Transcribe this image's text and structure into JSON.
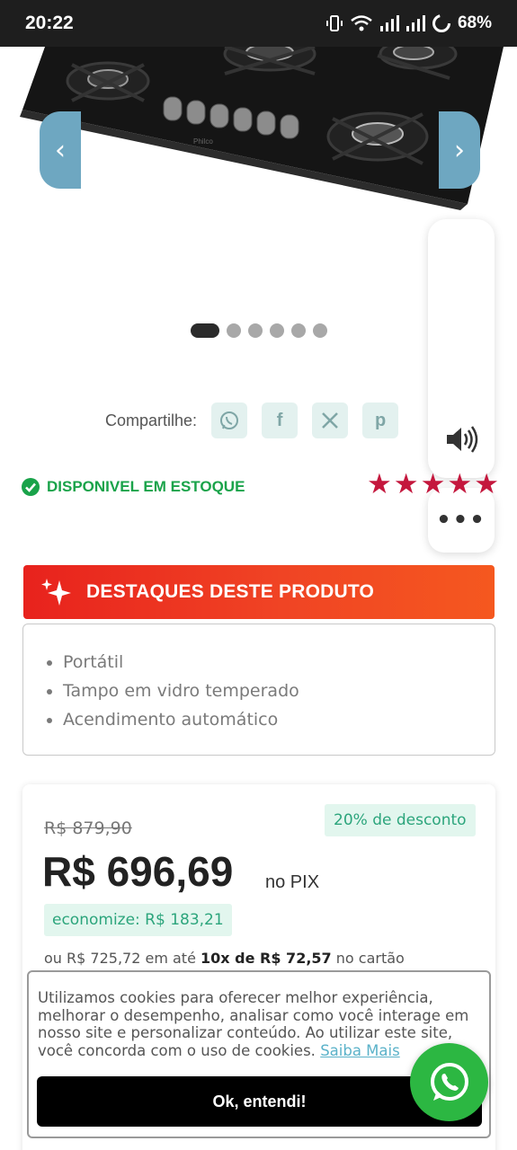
{
  "status_bar": {
    "time": "20:22",
    "battery": "68%",
    "icons": [
      "vibrate-icon",
      "wifi-icon",
      "signal-icon",
      "signal-icon",
      "battery-icon"
    ]
  },
  "carousel": {
    "dot_count": 6,
    "active_index": 0
  },
  "share": {
    "label": "Compartilhe:",
    "networks": [
      {
        "name": "whatsapp",
        "glyph": "✆"
      },
      {
        "name": "facebook",
        "glyph": "f"
      },
      {
        "name": "x",
        "glyph": "𝕏"
      },
      {
        "name": "pinterest",
        "glyph": "p"
      }
    ]
  },
  "stock": {
    "label": "DISPONIVEL EM ESTOQUE",
    "color": "#1aa34a"
  },
  "rating": {
    "stars": 5,
    "color": "#c4173d"
  },
  "highlights": {
    "title": "DESTAQUES DESTE PRODUTO",
    "items": [
      "Portátil",
      "Tampo em vidro temperado",
      "Acendimento automático"
    ]
  },
  "price": {
    "old": "R$ 879,90",
    "discount": "20% de desconto",
    "pix_price": "R$ 696,69",
    "pix_label": "no PIX",
    "savings": "economize: R$ 183,21",
    "installments_prefix": "ou R$ 725,72 em até",
    "installments_bold": "10x de R$ 72,57",
    "installments_suffix": "no cartão"
  },
  "cookie": {
    "text": "Utilizamos cookies para oferecer melhor experiência, melhorar o desempenho, analisar como você interage em nosso site e personalizar conteúdo. Ao utilizar este site, você concorda com o uso de cookies.",
    "link": "Saiba Mais",
    "button": "Ok, entendi!"
  },
  "colors": {
    "accent_red": "#e8221d",
    "green": "#2cb742",
    "badge_bg": "#e2f6ee",
    "badge_text": "#2ca57c"
  }
}
